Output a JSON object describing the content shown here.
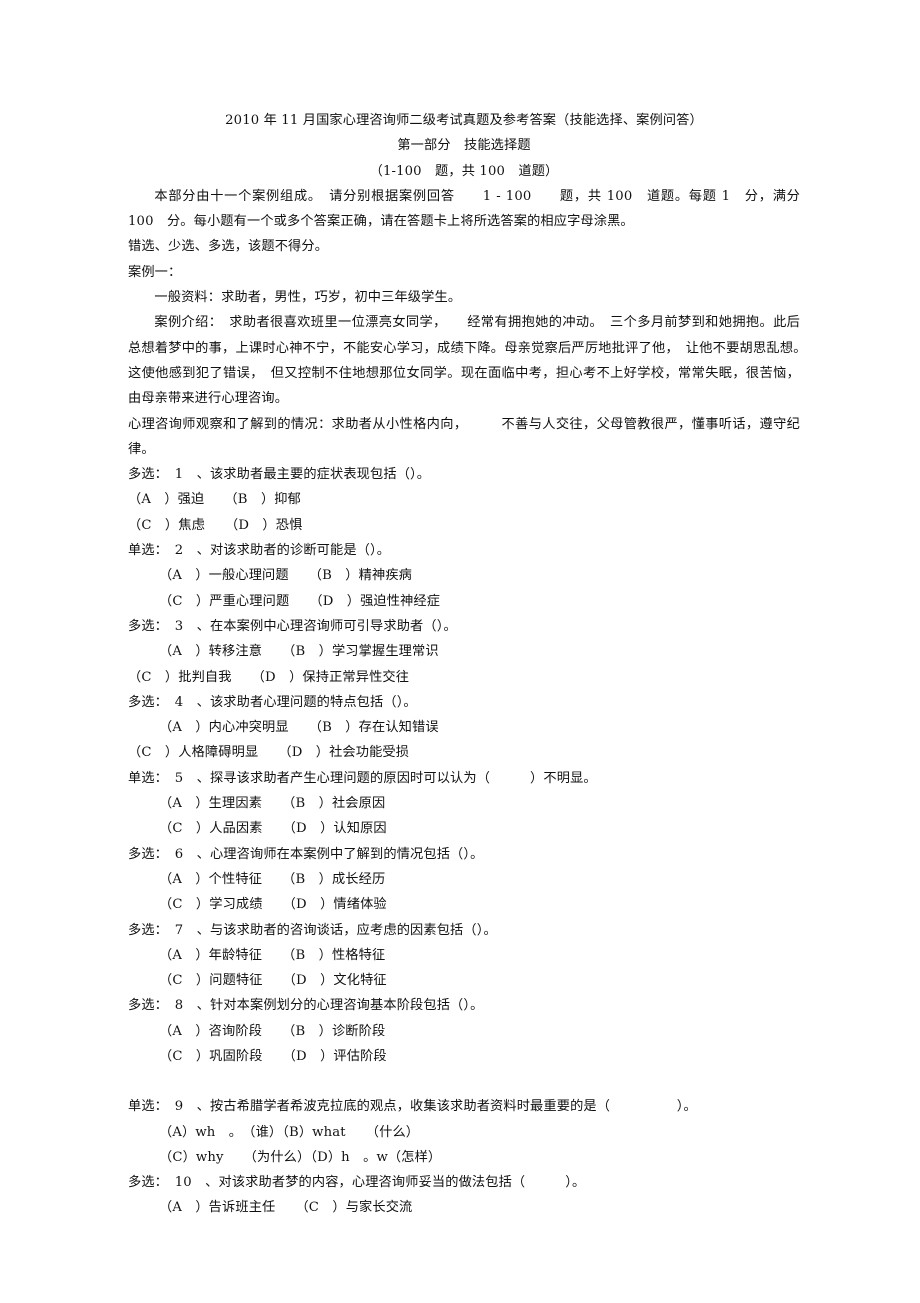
{
  "document": {
    "title_line": "2010 年 11 月国家心理咨询师二级考试真题及参考答案（技能选择、案例问答）",
    "section_heading": "第一部分　技能选择题",
    "section_range": "（1-100　题，共 100　道题）",
    "instructions": [
      "本部分由十一个案例组成。　请分别根据案例回答　　1 - 100　　题，共 100　道题。每题 1　分，满分 100　分。每小题有一个或多个答案正确，请在答题卡上将所选答案的相应字母涂黑。",
      "错选、少选、多选，该题不得分。"
    ],
    "case_label": "案例一：",
    "case_paragraphs": [
      "一般资料：求助者，男性，巧岁，初中三年级学生。",
      "案例介绍：　求助者很喜欢班里一位漂亮女同学，　　经常有拥抱她的冲动。　三个多月前梦到和她拥抱。此后总想着梦中的事，上课时心神不宁，不能安心学习，成绩下降。母亲觉察后严厉地批评了他，　让他不要胡思乱想。　这使他感到犯了错误，　但又控制不住地想那位女同学。现在面临中考，担心考不上好学校，常常失眠，很苦恼，由母亲带来进行心理咨询。",
      "心理咨询师观察和了解到的情况：求助者从小性格内向，　　　不善与人交往，父母管教很严，懂事听话，遵守纪律。"
    ],
    "questions": [
      {
        "stem": "多选：　1　、该求助者最主要的症状表现包括（）。",
        "rows": [
          {
            "text": "（A　）强迫　　（B　）抑郁",
            "indent": "flush"
          },
          {
            "text": "（C　）焦虑　　（D　）恐惧",
            "indent": "flush"
          }
        ]
      },
      {
        "stem": "单选：　2　、对该求助者的诊断可能是（）。",
        "rows": [
          {
            "text": "（A　）一般心理问题　　（B　）精神疾病",
            "indent": "indent"
          },
          {
            "text": "（C　）严重心理问题　　（D　）强迫性神经症",
            "indent": "indent"
          }
        ]
      },
      {
        "stem": "多选：　3　、在本案例中心理咨询师可引导求助者（）。",
        "rows": [
          {
            "text": "（A　）转移注意　　（B　）学习掌握生理常识",
            "indent": "indent"
          },
          {
            "text": "（C　）批判自我　　（D　）保持正常异性交往",
            "indent": "flush"
          }
        ]
      },
      {
        "stem": "多选：　4　、该求助者心理问题的特点包括（）。",
        "rows": [
          {
            "text": "（A　）内心冲突明显　　（B　）存在认知错误",
            "indent": "indent"
          },
          {
            "text": "（C　）人格障碍明显　　（D　）社会功能受损",
            "indent": "flush"
          }
        ]
      },
      {
        "stem": "单选：　5　、探寻该求助者产生心理问题的原因时可以认为（　　　）不明显。",
        "rows": [
          {
            "text": "（A　）生理因素　　（B　）社会原因",
            "indent": "indent"
          },
          {
            "text": "（C　）人品因素　　（D　）认知原因",
            "indent": "indent"
          }
        ]
      },
      {
        "stem": "多选：　6　、心理咨询师在本案例中了解到的情况包括（）。",
        "rows": [
          {
            "text": "（A　）个性特征　　（B　）成长经历",
            "indent": "indent"
          },
          {
            "text": "（C　）学习成绩　　（D　）情绪体验",
            "indent": "indent"
          }
        ]
      },
      {
        "stem": "多选：　7　、与该求助者的咨询谈话，应考虑的因素包括（）。",
        "rows": [
          {
            "text": "（A　）年龄特征　　（B　）性格特征",
            "indent": "indent"
          },
          {
            "text": "（C　）问题特征　　（D　）文化特征",
            "indent": "indent"
          }
        ]
      },
      {
        "stem": "多选：　8　、针对本案例划分的心理咨询基本阶段包括（）。",
        "rows": [
          {
            "text": "（A　）咨询阶段　　（B　）诊断阶段",
            "indent": "indent"
          },
          {
            "text": "（C　）巩固阶段　　（D　）评估阶段",
            "indent": "indent"
          }
        ]
      },
      {
        "stem": "单选：　9　、按古希腊学者希波克拉底的观点，收集该求助者资料时最重要的是（　　　　　）。",
        "rows": [
          {
            "text": "（A）wh　。　（谁）（B）what　　（什么）",
            "indent": "indent"
          },
          {
            "text": "（C）why　　（为什么）（D）h　。w（怎样）",
            "indent": "indent"
          }
        ]
      },
      {
        "stem": "多选：　10　、对该求助者梦的内容，心理咨询师妥当的做法包括（　　　）。",
        "rows": [
          {
            "text": "（A　）告诉班主任　　（C　）与家长交流",
            "indent": "indent"
          }
        ]
      }
    ]
  }
}
